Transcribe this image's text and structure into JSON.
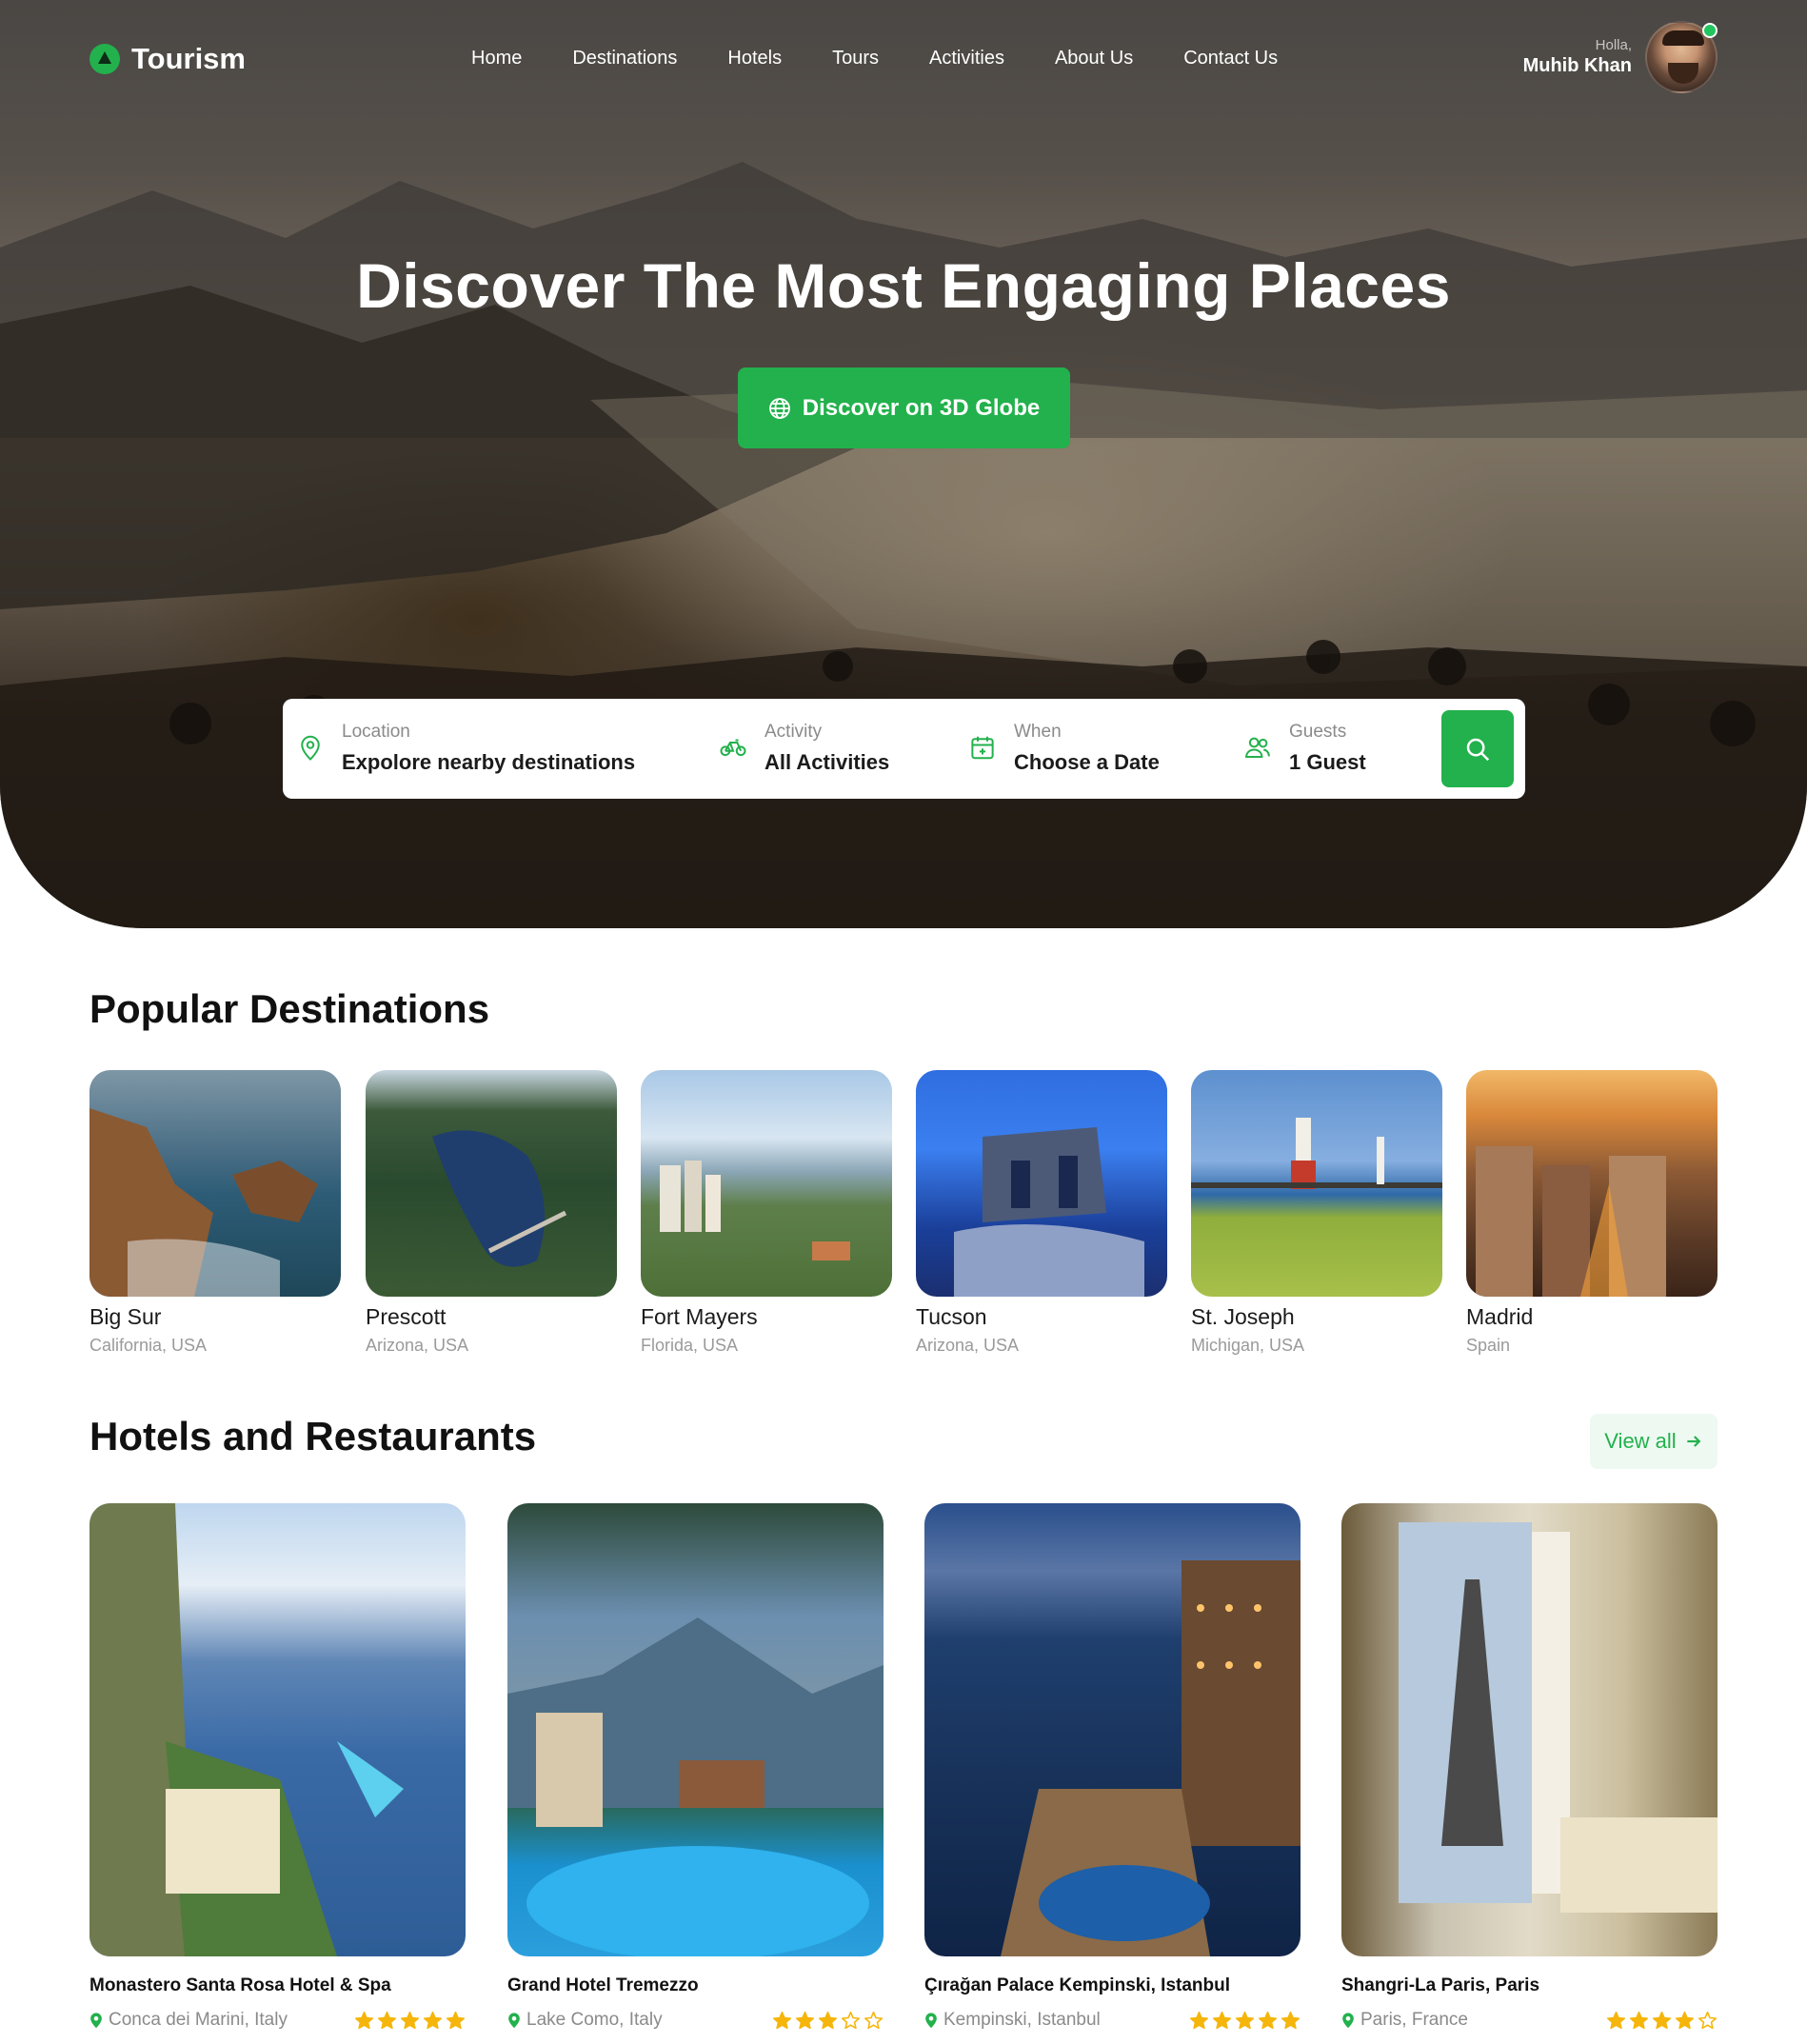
{
  "brand": {
    "name": "Tourism",
    "accent": "#22b14c"
  },
  "nav": [
    "Home",
    "Destinations",
    "Hotels",
    "Tours",
    "Activities",
    "About Us",
    "Contact Us"
  ],
  "user": {
    "greeting": "Holla,",
    "name": "Muhib Khan",
    "status": "online"
  },
  "hero": {
    "title": "Discover The Most Engaging Places",
    "cta_label": "Discover on 3D Globe",
    "cta_icon": "globe-icon"
  },
  "search": {
    "location": {
      "label": "Location",
      "value": "Expolore nearby destinations",
      "icon": "map-pin-icon"
    },
    "activity": {
      "label": "Activity",
      "value": "All Activities",
      "icon": "bicycle-icon"
    },
    "when": {
      "label": "When",
      "value": "Choose a Date",
      "icon": "calendar-icon"
    },
    "guests": {
      "label": "Guests",
      "value": "1 Guest",
      "icon": "users-icon"
    },
    "button_icon": "search-icon"
  },
  "popular": {
    "title": "Popular Destinations",
    "items": [
      {
        "name": "Big Sur",
        "location": "California, USA"
      },
      {
        "name": "Prescott",
        "location": "Arizona, USA"
      },
      {
        "name": "Fort Mayers",
        "location": "Florida, USA"
      },
      {
        "name": "Tucson",
        "location": "Arizona, USA"
      },
      {
        "name": "St. Joseph",
        "location": "Michigan, USA"
      },
      {
        "name": "Madrid",
        "location": "Spain"
      }
    ]
  },
  "hotels": {
    "title": "Hotels and Restaurants",
    "view_all": "View all",
    "items": [
      {
        "name": "Monastero Santa Rosa Hotel & Spa",
        "location": "Conca dei Marini, Italy",
        "rating": 5
      },
      {
        "name": "Grand Hotel Tremezzo",
        "location": "Lake Como, Italy",
        "rating": 3
      },
      {
        "name": "Çırağan Palace Kempinski, Istanbul",
        "location": "Kempinski, Istanbul",
        "rating": 5
      },
      {
        "name": "Shangri-La Paris, Paris",
        "location": "Paris, France",
        "rating": 4
      }
    ]
  }
}
